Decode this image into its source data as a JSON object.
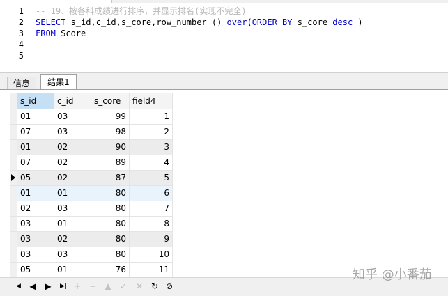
{
  "editor": {
    "line_numbers": [
      "1",
      "2",
      "3",
      "4",
      "5"
    ],
    "lines": [
      [
        {
          "t": "-- 19、按各科成绩进行排序，并显示排名(实现不完全)",
          "c": "comment"
        }
      ],
      [
        {
          "t": "SELECT",
          "c": "kw"
        },
        {
          "t": " s_id,c_id,s_core,row_number () ",
          "c": "plain"
        },
        {
          "t": "over",
          "c": "kw"
        },
        {
          "t": "(",
          "c": "plain"
        },
        {
          "t": "ORDER BY",
          "c": "kw"
        },
        {
          "t": " s_core ",
          "c": "plain"
        },
        {
          "t": "desc",
          "c": "kw"
        },
        {
          "t": " )",
          "c": "plain"
        }
      ],
      [
        {
          "t": "FROM",
          "c": "kw"
        },
        {
          "t": " Score",
          "c": "plain"
        }
      ],
      [],
      []
    ]
  },
  "tabs": {
    "info": "信息",
    "result": "结果1"
  },
  "grid": {
    "columns": [
      "s_id",
      "c_id",
      "s_core",
      "field4"
    ],
    "selected_column": 0,
    "current_row": 4,
    "rows": [
      [
        "01",
        "03",
        "99",
        "1"
      ],
      [
        "07",
        "03",
        "98",
        "2"
      ],
      [
        "01",
        "02",
        "90",
        "3"
      ],
      [
        "07",
        "02",
        "89",
        "4"
      ],
      [
        "05",
        "02",
        "87",
        "5"
      ],
      [
        "01",
        "01",
        "80",
        "6"
      ],
      [
        "02",
        "03",
        "80",
        "7"
      ],
      [
        "03",
        "01",
        "80",
        "8"
      ],
      [
        "03",
        "02",
        "80",
        "9"
      ],
      [
        "03",
        "03",
        "80",
        "10"
      ],
      [
        "05",
        "01",
        "76",
        "11"
      ]
    ]
  },
  "navbar": {
    "buttons": [
      {
        "name": "first-record-button",
        "glyph": "|◀",
        "enabled": true
      },
      {
        "name": "prev-record-button",
        "glyph": "◀",
        "enabled": true
      },
      {
        "name": "next-record-button",
        "glyph": "▶",
        "enabled": true
      },
      {
        "name": "last-record-button",
        "glyph": "▶|",
        "enabled": true
      },
      {
        "name": "add-record-button",
        "glyph": "+",
        "enabled": false
      },
      {
        "name": "delete-record-button",
        "glyph": "−",
        "enabled": false
      },
      {
        "name": "edit-record-button",
        "glyph": "▲",
        "enabled": false
      },
      {
        "name": "post-edit-button",
        "glyph": "✓",
        "enabled": false
      },
      {
        "name": "cancel-edit-button",
        "glyph": "✕",
        "enabled": false
      },
      {
        "name": "refresh-button",
        "glyph": "↻",
        "enabled": true
      },
      {
        "name": "stop-button",
        "glyph": "⊘",
        "enabled": true
      }
    ]
  },
  "watermark": "知乎 @小番茄"
}
